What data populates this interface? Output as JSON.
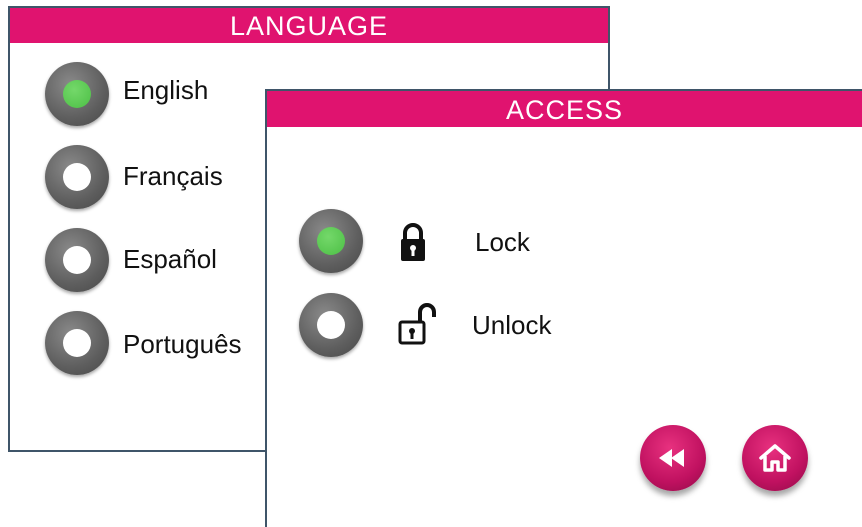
{
  "language_panel": {
    "title": "LANGUAGE",
    "options": [
      {
        "label": "English",
        "selected": true
      },
      {
        "label": "Français",
        "selected": false
      },
      {
        "label": "Español",
        "selected": false
      },
      {
        "label": "Português",
        "selected": false
      }
    ]
  },
  "access_panel": {
    "title": "ACCESS",
    "options": [
      {
        "label": "Lock",
        "icon": "lock-closed-icon",
        "selected": true
      },
      {
        "label": "Unlock",
        "icon": "lock-open-icon",
        "selected": false
      }
    ],
    "buttons": [
      {
        "name": "back-button",
        "icon": "rewind-icon"
      },
      {
        "name": "home-button",
        "icon": "home-icon"
      }
    ]
  },
  "colors": {
    "header_accent": "#e0136f",
    "panel_border": "#3f5569",
    "radio_selected": "#4cbf45",
    "radio_ring": "#5e5e5e",
    "button_fill": "#c01160"
  }
}
